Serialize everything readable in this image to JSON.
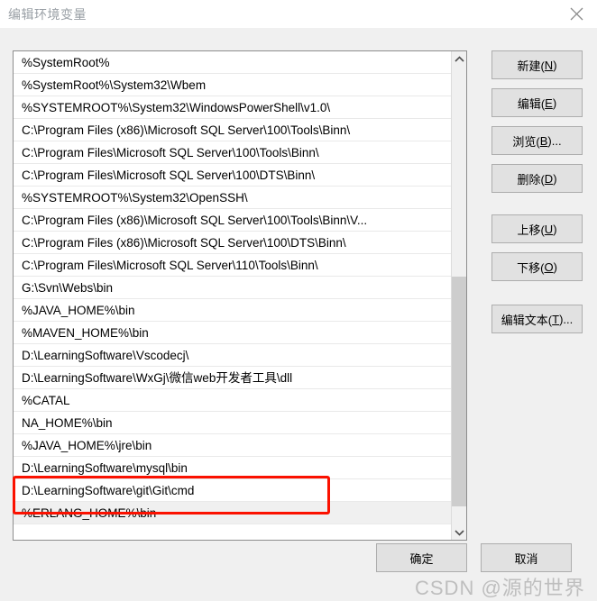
{
  "window": {
    "title": "编辑环境变量",
    "close_icon": "close-icon"
  },
  "list": {
    "selected_index": 18,
    "items": [
      "%SystemRoot%",
      "%SystemRoot%\\System32\\Wbem",
      "%SYSTEMROOT%\\System32\\WindowsPowerShell\\v1.0\\",
      "C:\\Program Files (x86)\\Microsoft SQL Server\\100\\Tools\\Binn\\",
      "C:\\Program Files\\Microsoft SQL Server\\100\\Tools\\Binn\\",
      "C:\\Program Files\\Microsoft SQL Server\\100\\DTS\\Binn\\",
      "%SYSTEMROOT%\\System32\\OpenSSH\\",
      "C:\\Program Files (x86)\\Microsoft SQL Server\\100\\Tools\\Binn\\V...",
      "C:\\Program Files (x86)\\Microsoft SQL Server\\100\\DTS\\Binn\\",
      "C:\\Program Files\\Microsoft SQL Server\\110\\Tools\\Binn\\",
      "G:\\Svn\\Webs\\bin",
      "%JAVA_HOME%\\bin",
      "%MAVEN_HOME%\\bin",
      "D:\\LearningSoftware\\Vscodecj\\",
      "D:\\LearningSoftware\\WxGj\\微信web开发者工具\\dll",
      "%CATAL",
      "NA_HOME%\\bin",
      "%JAVA_HOME%\\jre\\bin",
      "D:\\LearningSoftware\\mysql\\bin",
      "D:\\LearningSoftware\\git\\Git\\cmd",
      "%ERLANG_HOME%\\bin",
      ""
    ]
  },
  "scrollbar": {
    "up_arrow_icon": "chevron-up-icon",
    "down_arrow_icon": "chevron-down-icon"
  },
  "side_buttons": [
    {
      "id": "new",
      "text": "新建(",
      "mnemonic": "N",
      "suffix": ")"
    },
    {
      "id": "edit",
      "text": "编辑(",
      "mnemonic": "E",
      "suffix": ")"
    },
    {
      "id": "browse",
      "text": "浏览(",
      "mnemonic": "B",
      "suffix": ")..."
    },
    {
      "id": "delete",
      "text": "删除(",
      "mnemonic": "D",
      "suffix": ")"
    },
    {
      "id": "move-up",
      "text": "上移(",
      "mnemonic": "U",
      "suffix": ")"
    },
    {
      "id": "move-down",
      "text": "下移(",
      "mnemonic": "O",
      "suffix": ")"
    },
    {
      "id": "edit-text",
      "text": "编辑文本(",
      "mnemonic": "T",
      "suffix": ")..."
    }
  ],
  "bottom_buttons": {
    "ok": "确定",
    "cancel": "取消"
  },
  "watermark": {
    "text": "CSDN @源的世界"
  },
  "colors": {
    "annotation": "#fb1100",
    "dialog_bg": "#f0f0f0",
    "button_bg": "#e1e1e1",
    "button_border": "#adadad",
    "selected_row": "#f0f0f0"
  }
}
